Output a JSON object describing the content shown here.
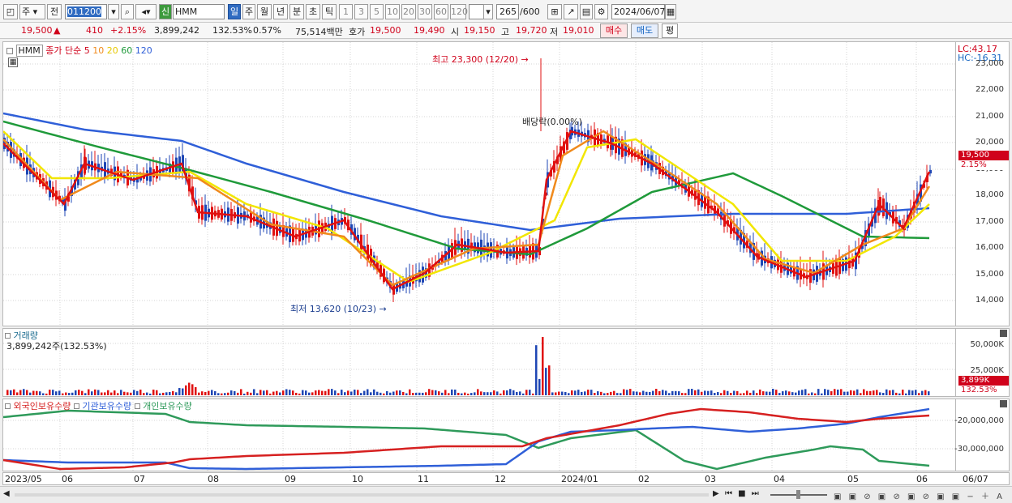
{
  "toolbar": {
    "market_select": "주",
    "prev_label": "전",
    "stock_code": "011200",
    "sin_label": "신",
    "stock_name": "HMM",
    "periods": [
      "일",
      "주",
      "월",
      "년",
      "분",
      "초",
      "틱"
    ],
    "intervals": [
      "1",
      "3",
      "5",
      "10",
      "20",
      "30",
      "60",
      "120"
    ],
    "count_value": "265",
    "count_total": "/600",
    "date_value": "2024/06/07"
  },
  "quote": {
    "price": "19,500",
    "arrow": "▲",
    "change": "410",
    "change_pct": "+2.15%",
    "volume": "3,899,242",
    "vol_ratio": "132.53%",
    "turnover": "0.57%",
    "amount": "75,514백만",
    "bid_label": "호가",
    "ask_price": "19,500",
    "bid_price": "19,490",
    "open_label": "시",
    "open_value": "19,150",
    "high_label": "고",
    "high_value": "19,720",
    "low_label": "저",
    "low_value": "19,010",
    "buy_label": "매수",
    "sell_label": "매도",
    "eval_label": "평"
  },
  "price_panel": {
    "symbol": "HMM",
    "ma_title": "종가 단순",
    "ma_periods": [
      "5",
      "10",
      "20",
      "60",
      "120"
    ],
    "ma_colors": [
      "#e01010",
      "#f08a1c",
      "#f2e600",
      "#1f9a3a",
      "#2f5fd8"
    ],
    "lc": "LC:43.17",
    "hc": "HC:-16.31",
    "y_ticks": [
      "23,000",
      "22,000",
      "21,000",
      "20,000",
      "19,000",
      "18,000",
      "17,000",
      "16,000",
      "15,000",
      "14,000"
    ],
    "last_price_tag": "19,500",
    "last_pct_tag": "2.15%",
    "high_annotation": "최고 23,300 (12/20)",
    "low_annotation": "최저 13,620 (10/23)",
    "dividend_annotation": "배당락(0.00%)"
  },
  "volume_panel": {
    "title": "거래량",
    "value": "3,899,242주(132.53%)",
    "y_ticks": [
      "50,000K",
      "25,000K"
    ],
    "last_tag": "3,899K",
    "last_pct": "132.53%"
  },
  "holdings_panel": {
    "series": [
      "외국인보유수량",
      "기관보유수량",
      "개인보유수량"
    ],
    "series_colors": [
      "#d62020",
      "#2f5fd8",
      "#2e9a5a"
    ],
    "y_ticks": [
      "-20,000,000",
      "-30,000,000"
    ]
  },
  "x_axis": {
    "labels": [
      "2023/05",
      "06",
      "07",
      "08",
      "09",
      "10",
      "11",
      "12",
      "2024/01",
      "02",
      "03",
      "04",
      "05",
      "06",
      "06/07"
    ]
  }
}
